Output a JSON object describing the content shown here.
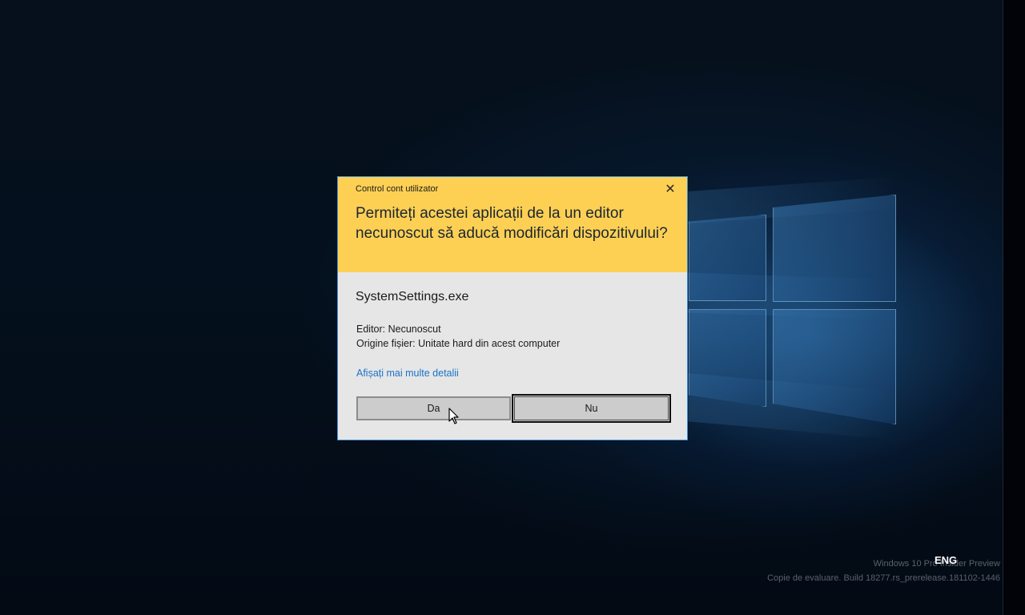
{
  "dialog": {
    "caption": "Control cont utilizator",
    "close_glyph": "✕",
    "question": "Permiteți acestei aplicații de la un editor necunoscut să aducă modificări dispozitivului?",
    "app_name": "SystemSettings.exe",
    "editor_line": "Editor: Necunoscut",
    "origin_line": "Origine fișier: Unitate hard din acest computer",
    "details_link": "Afișați mai multe detalii",
    "yes_label": "Da",
    "no_label": "Nu",
    "header_color": "#fdd054",
    "body_color": "#e6e6e6",
    "link_color": "#1a74c7"
  },
  "desktop": {
    "watermark_line1": "Windows 10 Pro Insider Preview",
    "watermark_line2": "Copie de evaluare. Build 18277.rs_prerelease.181102-1446",
    "language": "ENG"
  },
  "icons": {
    "close": "close-icon",
    "cursor": "mouse-pointer-icon"
  }
}
